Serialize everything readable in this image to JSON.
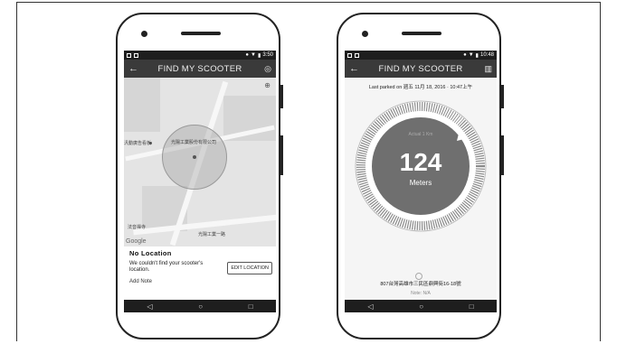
{
  "screen1": {
    "status_time": "3:50",
    "back_icon": "arrow-left-icon",
    "title": "FIND MY SCOOTER",
    "map_labels": {
      "shop": "汎動廣告看板",
      "company": "光陽工業股份有限公司",
      "fair": "法音禪寺",
      "road": "光陽工業一路"
    },
    "google_label": "Google",
    "location_heading": "No Location",
    "message": "We couldn't find your scooter's location.",
    "edit_button": "EDIT LOCATION",
    "add_note": "Add Note"
  },
  "screen2": {
    "status_time": "10:48",
    "title": "FIND MY SCOOTER",
    "last_parked": "Last parked on 週五 11月 18, 2016 · 10:47上午",
    "compass_header": "Actual 1 Km",
    "distance": "124",
    "unit": "Meters",
    "address": "807台灣高雄市三民區鼎興街16-18號",
    "note": "Note: N/A"
  },
  "navbar": {
    "back": "◁",
    "home": "○",
    "recent": "□"
  }
}
